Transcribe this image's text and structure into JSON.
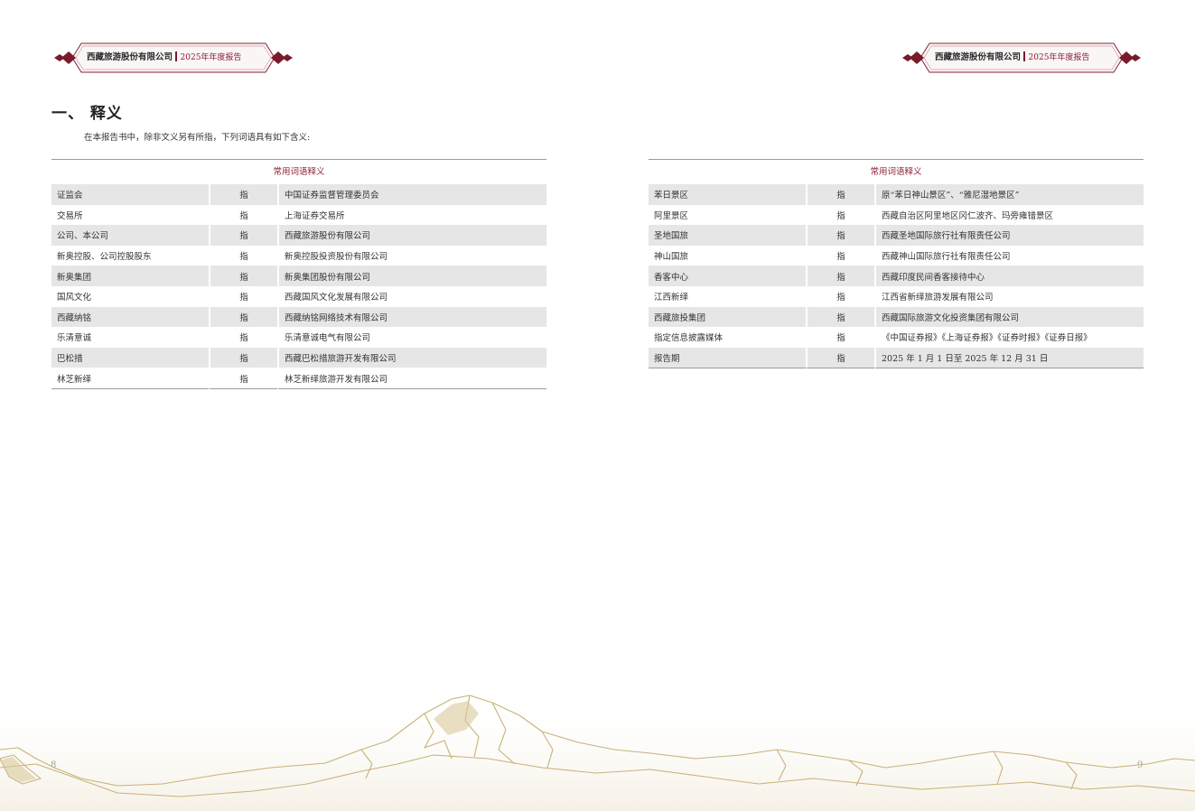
{
  "header": {
    "company": "西藏旅游股份有限公司",
    "report": "2025年年度报告"
  },
  "section": {
    "title": "一、 释义",
    "intro": "在本报告书中，除非文义另有所指，下列词语具有如下含义:"
  },
  "table_title": "常用词语释义",
  "left_table": [
    {
      "term": "证监会",
      "rel": "指",
      "meaning": "中国证券监督管理委员会"
    },
    {
      "term": "交易所",
      "rel": "指",
      "meaning": "上海证券交易所"
    },
    {
      "term": "公司、本公司",
      "rel": "指",
      "meaning": "西藏旅游股份有限公司"
    },
    {
      "term": "新奥控股、公司控股股东",
      "rel": "指",
      "meaning": "新奥控股投资股份有限公司"
    },
    {
      "term": "新奥集团",
      "rel": "指",
      "meaning": "新奥集团股份有限公司"
    },
    {
      "term": "国风文化",
      "rel": "指",
      "meaning": "西藏国风文化发展有限公司"
    },
    {
      "term": "西藏纳铭",
      "rel": "指",
      "meaning": "西藏纳铭网络技术有限公司"
    },
    {
      "term": "乐清意诚",
      "rel": "指",
      "meaning": "乐清意诚电气有限公司"
    },
    {
      "term": "巴松措",
      "rel": "指",
      "meaning": "西藏巴松措旅游开发有限公司"
    },
    {
      "term": "林芝新绎",
      "rel": "指",
      "meaning": "林芝新绎旅游开发有限公司"
    }
  ],
  "right_table": [
    {
      "term": "苯日景区",
      "rel": "指",
      "meaning": "原“苯日神山景区”、“雅尼湿地景区”"
    },
    {
      "term": "阿里景区",
      "rel": "指",
      "meaning": "西藏自治区阿里地区冈仁波齐、玛旁雍错景区"
    },
    {
      "term": "圣地国旅",
      "rel": "指",
      "meaning": "西藏圣地国际旅行社有限责任公司"
    },
    {
      "term": "神山国旅",
      "rel": "指",
      "meaning": "西藏神山国际旅行社有限责任公司"
    },
    {
      "term": "香客中心",
      "rel": "指",
      "meaning": "西藏印度民间香客接待中心"
    },
    {
      "term": "江西新绎",
      "rel": "指",
      "meaning": "江西省新绎旅游发展有限公司"
    },
    {
      "term": "西藏旅投集团",
      "rel": "指",
      "meaning": "西藏国际旅游文化投资集团有限公司"
    },
    {
      "term": "指定信息披露媒体",
      "rel": "指",
      "meaning": "《中国证券报》《上海证券报》《证券时报》《证券日报》"
    },
    {
      "term": "报告期",
      "rel": "指",
      "meaning": "2025 年 1 月 1 日至 2025 年 12 月 31 日"
    }
  ],
  "page_numbers": {
    "left": "8",
    "right": "9"
  },
  "colors": {
    "accent": "#8a2033",
    "shade": "#e6e6e6",
    "mountain": "#c9b27a"
  }
}
